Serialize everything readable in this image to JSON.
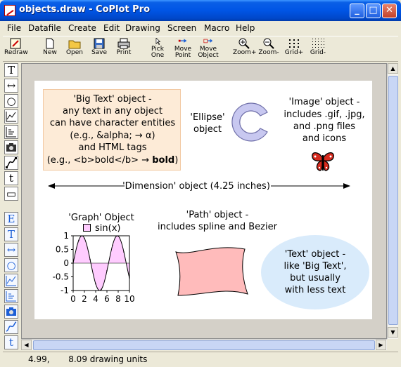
{
  "window": {
    "title": "objects.draw - CoPlot Pro",
    "app_icon": "drawing-app-icon",
    "buttons": [
      "minimize",
      "maximize",
      "close"
    ]
  },
  "menubar": [
    "File",
    "Datafile",
    "Create",
    "Edit",
    "Drawing",
    "Screen",
    "Macro",
    "Help"
  ],
  "toolbar": [
    {
      "name": "redraw",
      "label": "Redraw",
      "icon": "redraw-icon"
    },
    {
      "name": "new",
      "label": "New",
      "icon": "new-file-icon"
    },
    {
      "name": "open",
      "label": "Open",
      "icon": "open-folder-icon"
    },
    {
      "name": "save",
      "label": "Save",
      "icon": "save-disk-icon"
    },
    {
      "name": "print",
      "label": "Print",
      "icon": "printer-icon"
    },
    {
      "name": "pick-one",
      "label1": "Pick",
      "label2": "One",
      "icon": "pointer-icon"
    },
    {
      "name": "move-point",
      "label1": "Move",
      "label2": "Point",
      "icon": "move-point-icon"
    },
    {
      "name": "move-object",
      "label1": "Move",
      "label2": "Object",
      "icon": "move-object-icon"
    },
    {
      "name": "zoom-in",
      "label": "Zoom+",
      "icon": "zoom-in-icon"
    },
    {
      "name": "zoom-out",
      "label": "Zoom-",
      "icon": "zoom-out-icon"
    },
    {
      "name": "grid-plus",
      "label": "Grid+",
      "icon": "grid-icon"
    },
    {
      "name": "grid-minus",
      "label": "Grid-",
      "icon": "grid-icon"
    }
  ],
  "palette": {
    "top": [
      "T",
      "↔",
      "○",
      "graph",
      "table",
      "camera",
      "path",
      "t",
      "▭"
    ],
    "bottom": [
      "E",
      "T",
      "↔",
      "○",
      "graph",
      "table",
      "camera",
      "path",
      "t"
    ]
  },
  "drawing": {
    "bigtext": {
      "line1": "'Big Text' object -",
      "line2": "any text in any object",
      "line3": "can have character entities",
      "line4": "(e.g., &alpha; → α)",
      "line5": "and HTML tags",
      "line6_pre": "(e.g., <b>bold</b> → ",
      "line6_bold": "bold",
      "line6_post": ")"
    },
    "ellipse_label": {
      "line1": "'Ellipse'",
      "line2": "object"
    },
    "image_label": {
      "line1": "'Image' object -",
      "line2": "includes .gif, .jpg,",
      "line3": "and .png files",
      "line4": "and icons"
    },
    "dimension_label": "'Dimension' object (4.25 inches)",
    "graph": {
      "title": "'Graph' Object",
      "legend": "sin(x)",
      "fill_color": "#ffccff",
      "y_ticks": [
        "1",
        "0.5",
        "0",
        "-0.5",
        "-1"
      ],
      "x_ticks": [
        "0",
        "2",
        "4",
        "6",
        "8",
        "10"
      ]
    },
    "path_label": {
      "line1": "'Path' object -",
      "line2": "includes spline and Bezier"
    },
    "path_fill": "#ffbbbb",
    "text_label": {
      "line1": "'Text' object -",
      "line2": "like 'Big Text',",
      "line3": "but usually",
      "line4": "with less text"
    }
  },
  "chart_data": {
    "type": "line",
    "title": "'Graph' Object",
    "xlabel": "",
    "ylabel": "",
    "xlim": [
      0,
      10
    ],
    "ylim": [
      -1,
      1
    ],
    "series": [
      {
        "name": "sin(x)",
        "x": [
          0,
          1,
          2,
          3,
          4,
          5,
          6,
          7,
          8,
          9,
          10
        ],
        "values": [
          0,
          0.84,
          0.91,
          0.14,
          -0.76,
          -0.96,
          -0.28,
          0.66,
          0.99,
          0.41,
          -0.54
        ]
      }
    ],
    "grid": false,
    "legend": "top"
  },
  "status": {
    "text": "4.99,       8.09 drawing units"
  }
}
